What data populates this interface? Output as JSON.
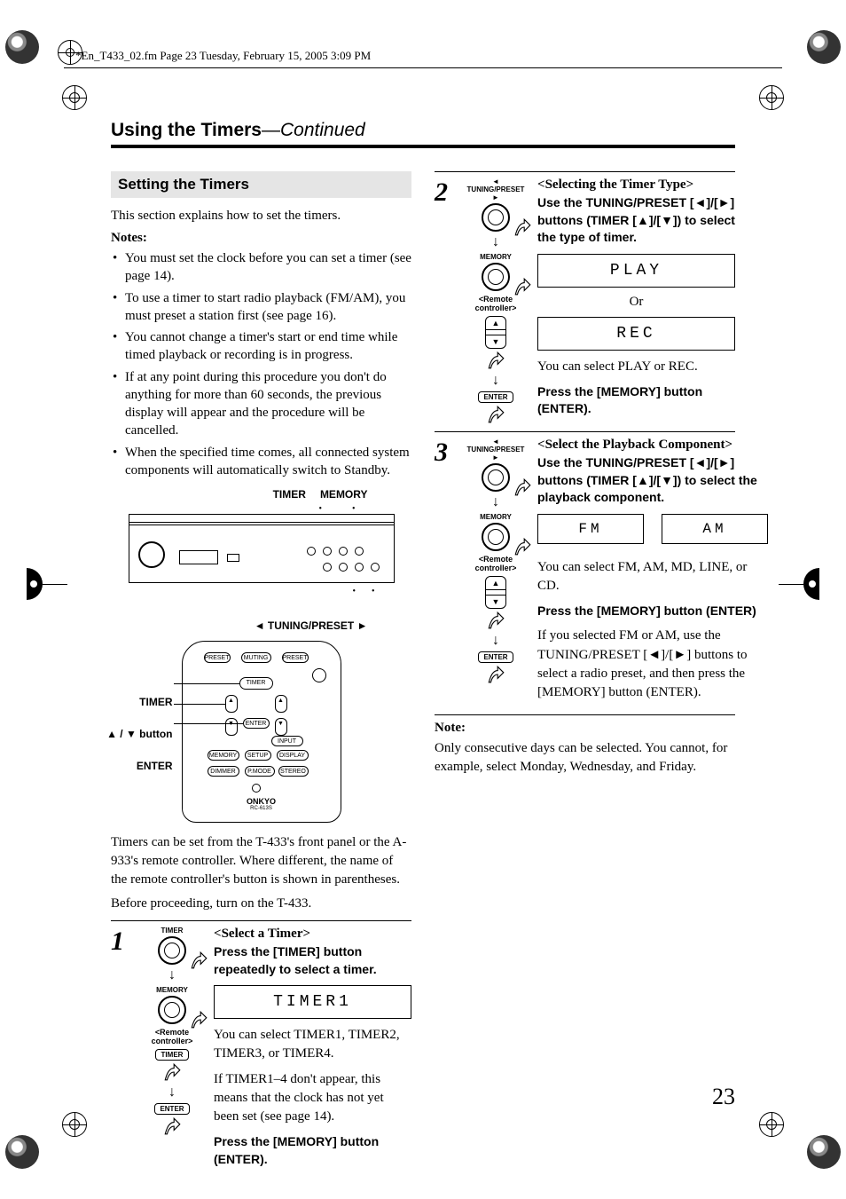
{
  "header_line": "*En_T433_02.fm  Page 23  Tuesday, February 15, 2005  3:09 PM",
  "chapter_title": "Using the Timers",
  "chapter_cont": "—Continued",
  "section_title": "Setting the Timers",
  "intro": "This section explains how to set the timers.",
  "notes_label": "Notes:",
  "notes": [
    "You must set the clock before you can set a timer (see page 14).",
    "To use a timer to start radio playback (FM/AM), you must preset a station first (see page 16).",
    "You cannot change a timer's start or end time while timed playback or recording is in progress.",
    "If at any point during this procedure you don't do anything for more than 60 seconds, the previous display will appear and the procedure will be cancelled.",
    "When the specified time comes, all connected system components will automatically switch to Standby."
  ],
  "fp_label_timer": "TIMER",
  "fp_label_memory": "MEMORY",
  "fp_label_tuning": "TUNING/PRESET",
  "rc_labels": {
    "timer": "TIMER",
    "updown": "▲ / ▼ button",
    "enter": "ENTER"
  },
  "para1": "Timers can be set from the T-433's front panel or the A-933's remote controller. Where different, the name of the remote controller's button is shown in parentheses.",
  "para2": "Before proceeding, turn on the T-433.",
  "controls": {
    "timer": "TIMER",
    "memory": "MEMORY",
    "tuning_preset": "TUNING/PRESET",
    "remote_label": "<Remote controller>",
    "enter": "ENTER"
  },
  "step1": {
    "num": "1",
    "head": "Select a Timer",
    "instr": "Press the [TIMER] button repeatedly to select a timer.",
    "lcd": "TIMER1",
    "text1": "You can select TIMER1, TIMER2, TIMER3, or TIMER4.",
    "text2": "If TIMER1–4 don't appear, this means that the clock has not yet been set (see page 14).",
    "instr2": "Press the [MEMORY] button (ENTER)."
  },
  "step2": {
    "num": "2",
    "head": "Selecting the Timer Type",
    "instr": "Use the TUNING/PRESET [◄]/[►] buttons (TIMER [▲]/[▼]) to select the type of timer.",
    "lcd1": "PLAY",
    "or": "Or",
    "lcd2": "REC",
    "text1": "You can select PLAY or REC.",
    "instr2": "Press the [MEMORY] button (ENTER)."
  },
  "step3": {
    "num": "3",
    "head": "Select the Playback Component",
    "instr": "Use the TUNING/PRESET [◄]/[►] buttons (TIMER [▲]/[▼]) to select the playback component.",
    "lcd1": "FM",
    "lcd2": "AM",
    "text1": "You can select FM, AM, MD, LINE, or CD.",
    "instr2": "Press the [MEMORY] button (ENTER)",
    "text2": "If you selected FM or AM, use the TUNING/PRESET [◄]/[►] buttons to select a radio preset, and then press the [MEMORY] button (ENTER)."
  },
  "bottom_note_label": "Note:",
  "bottom_note": "Only consecutive days can be selected. You cannot, for example, select Monday, Wednesday, and Friday.",
  "page_number": "23"
}
